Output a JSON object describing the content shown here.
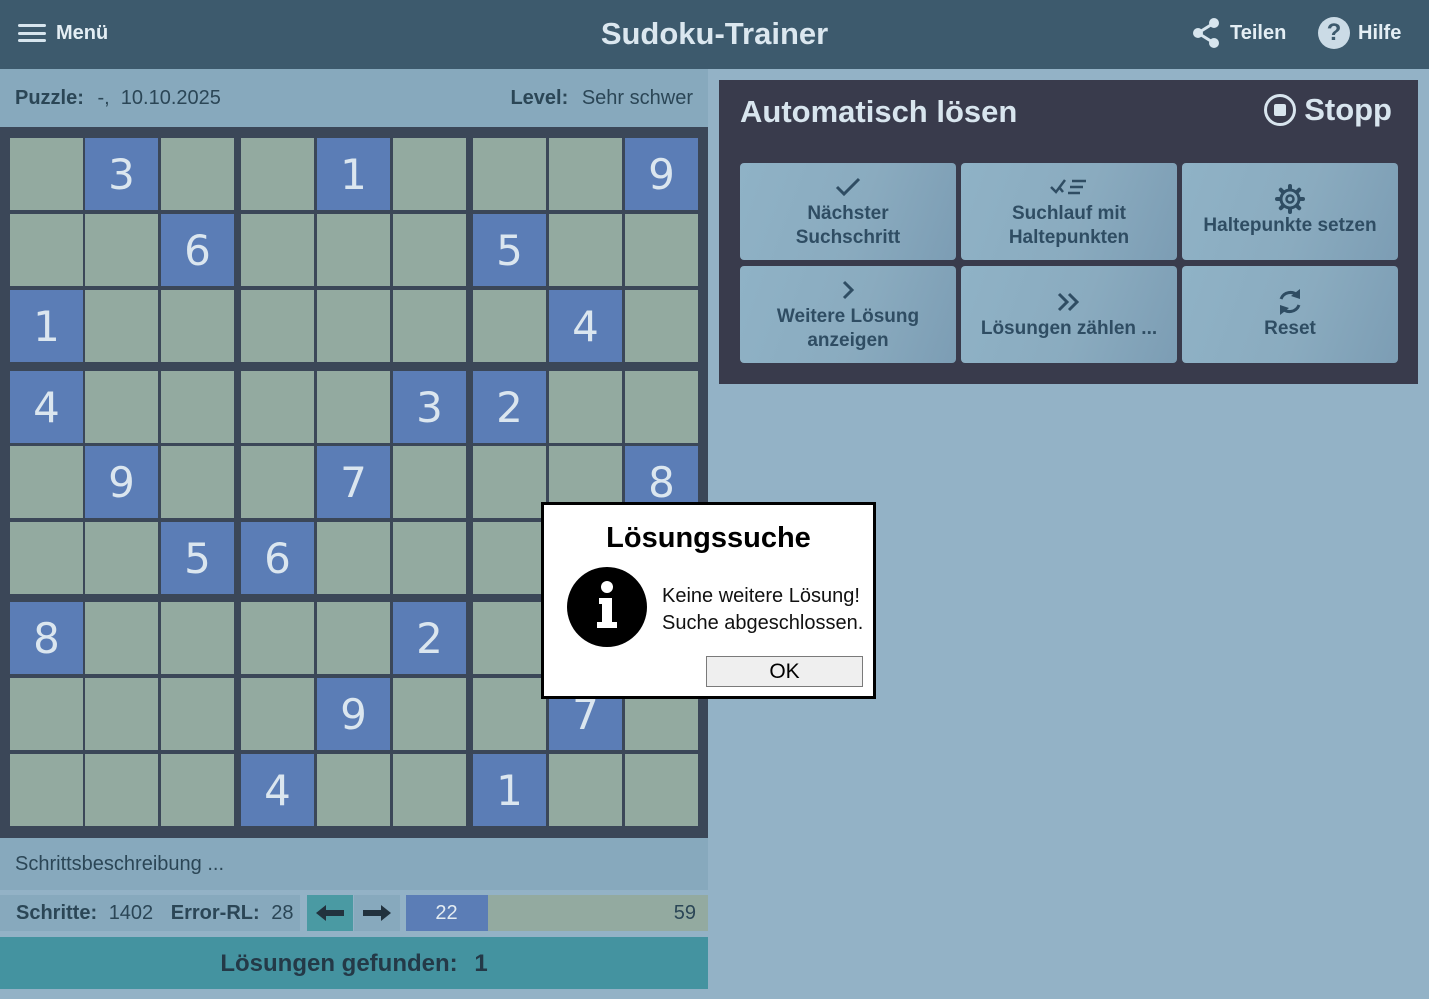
{
  "header": {
    "menu_label": "Menü",
    "title": "Sudoku-Trainer",
    "share_label": "Teilen",
    "help_label": "Hilfe",
    "help_glyph": "?"
  },
  "puzzle_info": {
    "puzzle_label": "Puzzle:",
    "puzzle_value": "-,  10.10.2025",
    "level_label": "Level:",
    "level_value": "Sehr schwer"
  },
  "board": {
    "rows": [
      [
        "",
        "3",
        "",
        "",
        "1",
        "",
        "",
        "",
        "9"
      ],
      [
        "",
        "",
        "6",
        "",
        "",
        "",
        "5",
        "",
        ""
      ],
      [
        "1",
        "",
        "",
        "",
        "",
        "",
        "",
        "4",
        ""
      ],
      [
        "4",
        "",
        "",
        "",
        "",
        "3",
        "2",
        "",
        ""
      ],
      [
        "",
        "9",
        "",
        "",
        "7",
        "",
        "",
        "",
        "8"
      ],
      [
        "",
        "",
        "5",
        "6",
        "",
        "",
        "",
        "",
        ""
      ],
      [
        "8",
        "",
        "",
        "",
        "",
        "2",
        "",
        "",
        ""
      ],
      [
        "",
        "",
        "",
        "",
        "9",
        "",
        "",
        "7",
        ""
      ],
      [
        "",
        "",
        "",
        "4",
        "",
        "",
        "1",
        "",
        ""
      ]
    ],
    "given_color": "#5b7db6",
    "empty_color": "#93aaa0"
  },
  "step_description": "Schrittsbeschreibung ...",
  "stats": {
    "steps_label": "Schritte:",
    "steps_value": "1402",
    "error_label": "Error-RL:",
    "error_value": "28",
    "prev_icon": "arrow-left-icon",
    "next_icon": "arrow-right-icon"
  },
  "progress": {
    "current": 22,
    "max": 59,
    "current_label": "22",
    "max_label": "59"
  },
  "solutions": {
    "label": "Lösungen gefunden:",
    "count": "1"
  },
  "auto_solve": {
    "title": "Automatisch lösen",
    "stop_label": "Stopp",
    "buttons": [
      {
        "icon": "check-icon",
        "line1": "Nächster",
        "line2": "Suchschritt"
      },
      {
        "icon": "checklist-icon",
        "line1": "Suchlauf mit",
        "line2": "Haltepunkten"
      },
      {
        "icon": "gear-icon",
        "line1": "Haltepunkte setzen",
        "line2": ""
      },
      {
        "icon": "chevron-right-icon",
        "line1": "Weitere Lösung",
        "line2": "anzeigen"
      },
      {
        "icon": "double-chevron-right-icon",
        "line1": "Lösungen zählen ...",
        "line2": ""
      },
      {
        "icon": "refresh-icon",
        "line1": "Reset",
        "line2": ""
      }
    ]
  },
  "dialog": {
    "title": "Lösungssuche",
    "line1": "Keine weitere Lösung!",
    "line2": "Suche abgeschlossen.",
    "ok_label": "OK"
  },
  "colors": {
    "header_bg": "#3d5a6d",
    "page_bg": "#93b2c6",
    "panel_bg": "#393b4c",
    "solutions_bg": "#4493a0"
  }
}
